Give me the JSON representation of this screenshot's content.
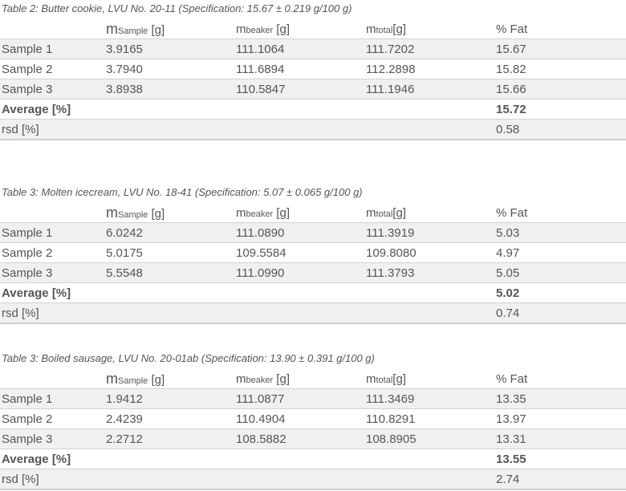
{
  "tables": [
    {
      "caption": "Table 2: Butter cookie, LVU No. 20-11 (Specification: 15.67 ± 0.219 g/100 g)",
      "headers": {
        "sample": {
          "m": "m",
          "sub": "Sample",
          "unit": " [g]"
        },
        "beaker": {
          "m": "m",
          "sub": "beaker",
          "unit": " [g]"
        },
        "total": {
          "m": "m",
          "sub": "total",
          "unit": "[g]"
        },
        "fat": "% Fat"
      },
      "rows": [
        {
          "label": "Sample 1",
          "sample": "3.9165",
          "beaker": "111.1064",
          "total": "111.7202",
          "fat": "15.67"
        },
        {
          "label": "Sample 2",
          "sample": "3.7940",
          "beaker": "111.6894",
          "total": "112.2898",
          "fat": "15.82"
        },
        {
          "label": "Sample 3",
          "sample": "3.8938",
          "beaker": "110.5847",
          "total": "111.1946",
          "fat": "15.66"
        }
      ],
      "average": {
        "label": "Average [%]",
        "value": "15.72"
      },
      "rsd": {
        "label": "rsd [%]",
        "value": "0.58"
      }
    },
    {
      "caption": "Table 3: Molten icecream, LVU No. 18-41 (Specification: 5.07 ± 0.065 g/100 g)",
      "headers": {
        "sample": {
          "m": "m",
          "sub": "Sample",
          "unit": " [g]"
        },
        "beaker": {
          "m": "m",
          "sub": "beaker",
          "unit": " [g]"
        },
        "total": {
          "m": "m",
          "sub": "total",
          "unit": "[g]"
        },
        "fat": "% Fat"
      },
      "rows": [
        {
          "label": "Sample 1",
          "sample": "6.0242",
          "beaker": "111.0890",
          "total": "111.3919",
          "fat": "5.03"
        },
        {
          "label": "Sample 2",
          "sample": "5.0175",
          "beaker": "109.5584",
          "total": "109.8080",
          "fat": "4.97"
        },
        {
          "label": "Sample 3",
          "sample": "5.5548",
          "beaker": "111.0990",
          "total": "111.3793",
          "fat": "5.05"
        }
      ],
      "average": {
        "label": "Average [%]",
        "value": "5.02"
      },
      "rsd": {
        "label": "rsd [%]",
        "value": "0.74"
      }
    },
    {
      "caption": "Table 3: Boiled sausage, LVU No. 20-01ab (Specification: 13.90 ± 0.391 g/100 g)",
      "headers": {
        "sample": {
          "m": "m",
          "sub": "Sample",
          "unit": " [g]"
        },
        "beaker": {
          "m": "m",
          "sub": "beaker",
          "unit": " [g]"
        },
        "total": {
          "m": "m",
          "sub": "total",
          "unit": "[g]"
        },
        "fat": "% Fat"
      },
      "rows": [
        {
          "label": "Sample 1",
          "sample": "1.9412",
          "beaker": "111.0877",
          "total": "111.3469",
          "fat": "13.35"
        },
        {
          "label": "Sample 2",
          "sample": "2.4239",
          "beaker": "110.4904",
          "total": "110.8291",
          "fat": "13.97"
        },
        {
          "label": "Sample 3",
          "sample": "2.2712",
          "beaker": "108.5882",
          "total": "108.8905",
          "fat": "13.31"
        }
      ],
      "average": {
        "label": "Average [%]",
        "value": "13.55"
      },
      "rsd": {
        "label": "rsd [%]",
        "value": "2.74"
      }
    }
  ]
}
